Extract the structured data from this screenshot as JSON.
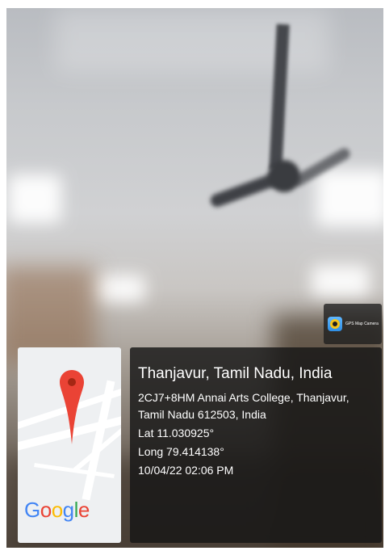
{
  "watermark": {
    "app_name": "GPS Map Camera",
    "icon": "gps-map-camera-icon"
  },
  "location": {
    "title": "Thanjavur, Tamil Nadu, India",
    "address": "2CJ7+8HM Annai Arts College, Thanjavur, Tamil Nadu 612503, India",
    "lat": "Lat 11.030925°",
    "long": "Long 79.414138°",
    "datetime": "10/04/22 02:06 PM"
  },
  "map": {
    "brand": "Google",
    "pin_icon": "map-pin-icon",
    "colors": {
      "pin": "#ea4335",
      "g_blue": "#4285f4",
      "g_red": "#ea4335",
      "g_yellow": "#fbbc05",
      "g_green": "#34a853"
    }
  }
}
